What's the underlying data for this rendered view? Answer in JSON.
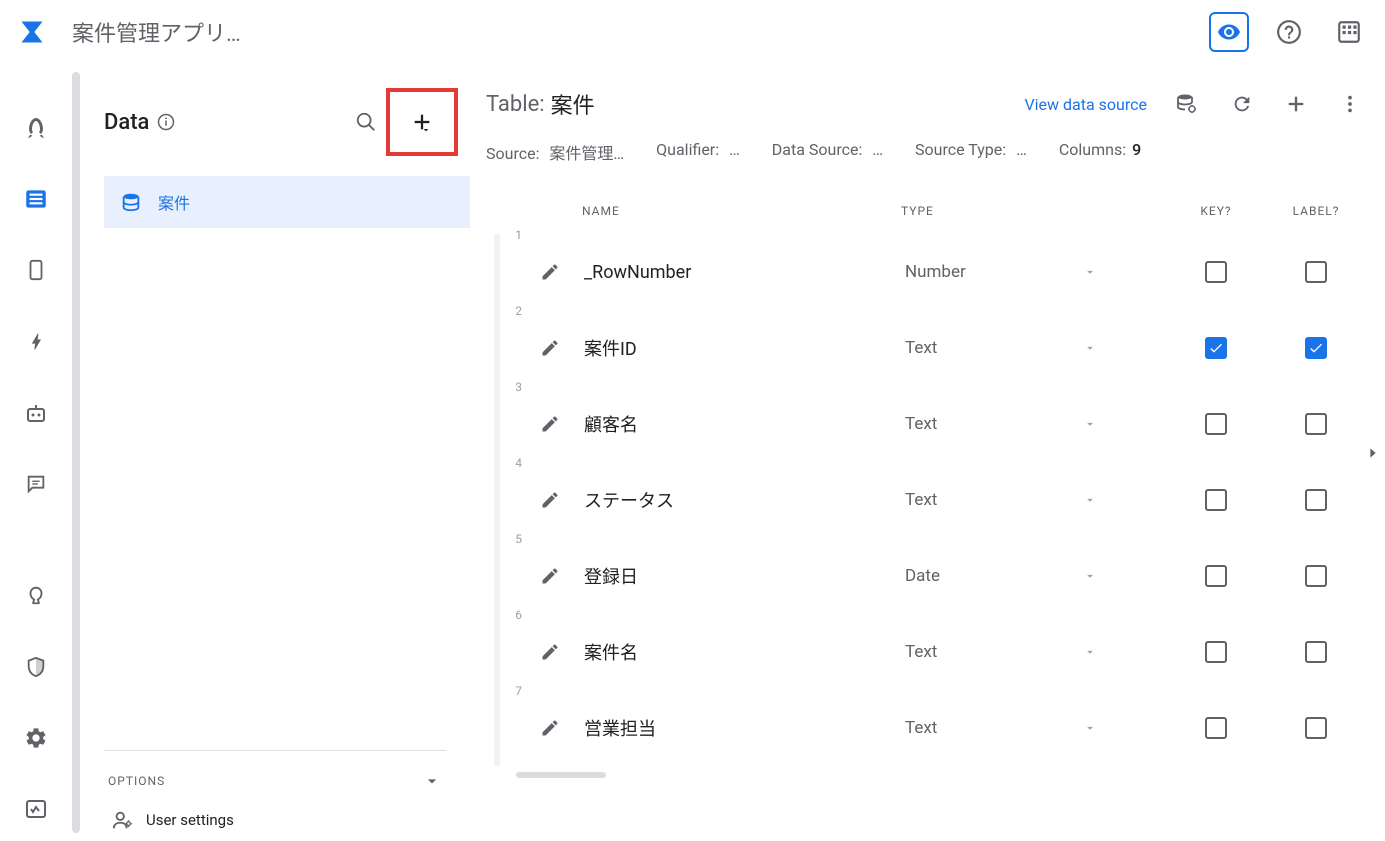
{
  "app": {
    "title": "案件管理アプリ…"
  },
  "sidebar": {
    "title": "Data",
    "selected_table": "案件",
    "options_label": "OPTIONS",
    "user_settings_label": "User settings"
  },
  "main": {
    "title_label": "Table:",
    "title_value": "案件",
    "view_source_label": "View data source",
    "meta": {
      "source_label": "Source:",
      "source_value": "案件管理…",
      "qualifier_label": "Qualifier:",
      "qualifier_value": "…",
      "datasource_label": "Data Source:",
      "datasource_value": "…",
      "sourcetype_label": "Source Type:",
      "sourcetype_value": "…",
      "columns_label": "Columns:",
      "columns_value": "9"
    },
    "headers": {
      "name": "NAME",
      "type": "TYPE",
      "key": "KEY?",
      "label": "LABEL?"
    },
    "rows": [
      {
        "n": "1",
        "name": "_RowNumber",
        "type": "Number",
        "key": false,
        "label": false
      },
      {
        "n": "2",
        "name": "案件ID",
        "type": "Text",
        "key": true,
        "label": true
      },
      {
        "n": "3",
        "name": "顧客名",
        "type": "Text",
        "key": false,
        "label": false
      },
      {
        "n": "4",
        "name": "ステータス",
        "type": "Text",
        "key": false,
        "label": false
      },
      {
        "n": "5",
        "name": "登録日",
        "type": "Date",
        "key": false,
        "label": false
      },
      {
        "n": "6",
        "name": "案件名",
        "type": "Text",
        "key": false,
        "label": false
      },
      {
        "n": "7",
        "name": "営業担当",
        "type": "Text",
        "key": false,
        "label": false
      }
    ]
  }
}
